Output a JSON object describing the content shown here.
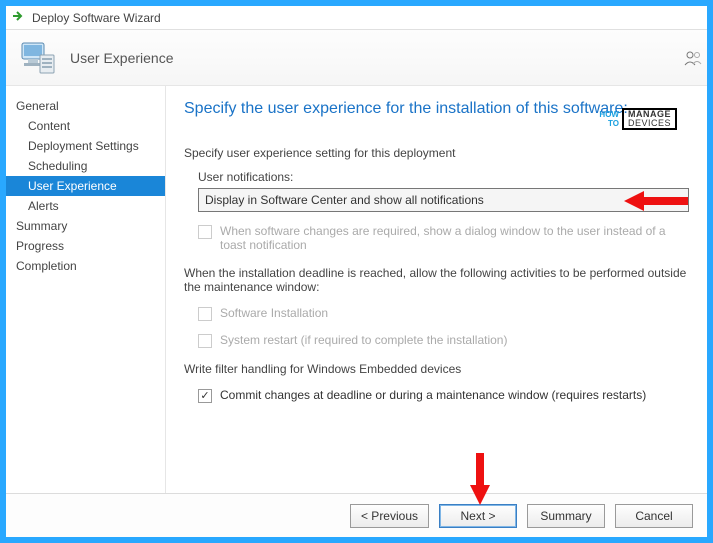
{
  "window": {
    "title": "Deploy Software Wizard"
  },
  "header": {
    "title": "User Experience"
  },
  "sidebar": {
    "items": [
      {
        "label": "General",
        "indent": 0
      },
      {
        "label": "Content",
        "indent": 1
      },
      {
        "label": "Deployment Settings",
        "indent": 1
      },
      {
        "label": "Scheduling",
        "indent": 1
      },
      {
        "label": "User Experience",
        "indent": 1,
        "selected": true
      },
      {
        "label": "Alerts",
        "indent": 1
      },
      {
        "label": "Summary",
        "indent": 0
      },
      {
        "label": "Progress",
        "indent": 0
      },
      {
        "label": "Completion",
        "indent": 0
      }
    ]
  },
  "content": {
    "title": "Specify the user experience for the installation of this software:",
    "sec1": "Specify user experience setting for this deployment",
    "user_notifications_label": "User notifications:",
    "user_notifications_value": "Display in Software Center and show all notifications",
    "toast_checkbox": "When software changes are required, show a dialog window to the user instead of a toast notification",
    "deadline_intro": "When the installation deadline is reached, allow the following activities to be performed outside the maintenance window:",
    "opt_software_install": "Software Installation",
    "opt_system_restart": "System restart  (if required to complete the installation)",
    "embedded_label": "Write filter handling for Windows Embedded devices",
    "commit_checkbox": "Commit changes at deadline or during a maintenance window (requires restarts)"
  },
  "footer": {
    "previous": "<  Previous",
    "next": "Next  >",
    "summary": "Summary",
    "cancel": "Cancel"
  },
  "badge": {
    "howto": "HOW\nTO",
    "line1": "MANAGE",
    "line2": "DEVICES"
  }
}
